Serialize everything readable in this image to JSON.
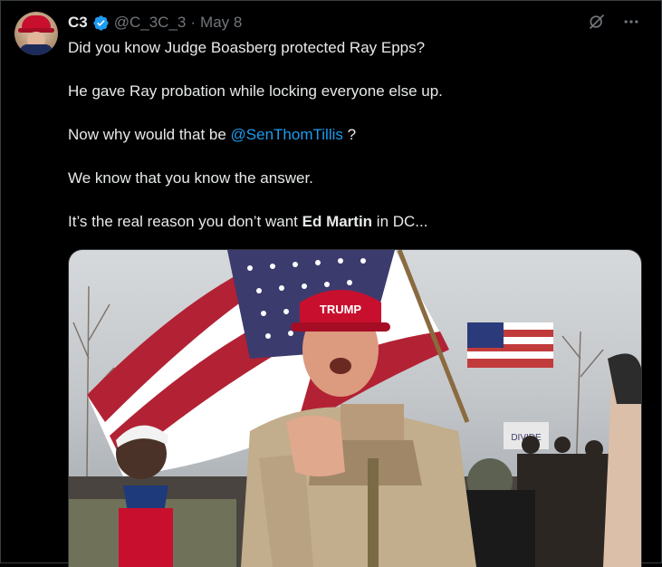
{
  "tweet": {
    "author_name": "C3",
    "handle": "@C_3C_3",
    "separator": "·",
    "date": "May 8",
    "paragraphs": {
      "p1": "Did you know Judge Boasberg protected Ray Epps?",
      "p2": "He gave Ray probation while locking everyone else up.",
      "p3_before": "Now why would that be ",
      "p3_mention": "@SenThomTillis",
      "p3_after": " ?",
      "p4": "We know that you know the answer.",
      "p5_before": "It’s the real reason you don’t want ",
      "p5_bold": "Ed Martin",
      "p5_after": " in DC..."
    },
    "media": {
      "hat_text": "TRUMP",
      "sign_text": "DIVIDE"
    }
  },
  "icons": {
    "verified": "verified-badge-icon",
    "grok": "grok-icon",
    "more": "more-icon"
  },
  "colors": {
    "background": "#000000",
    "text": "#e7e9ea",
    "secondary": "#71767b",
    "link": "#1d9bf0",
    "verified": "#1d9bf0"
  }
}
